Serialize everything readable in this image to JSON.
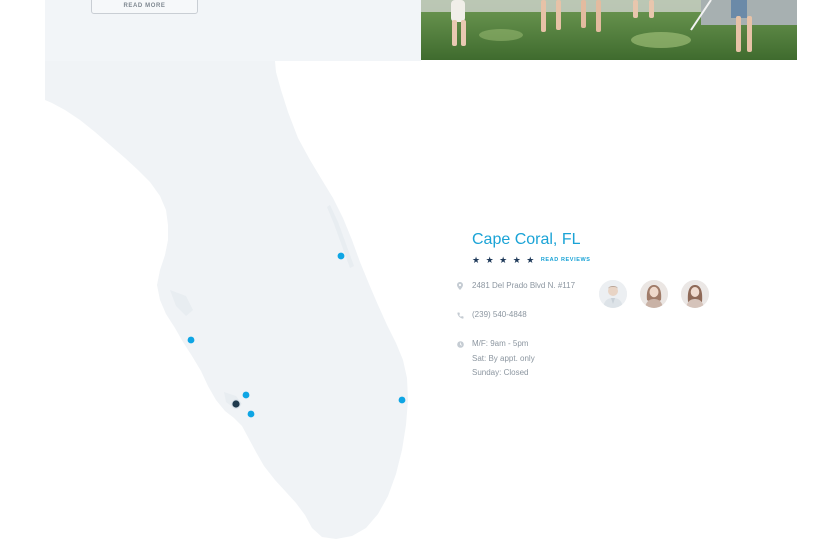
{
  "intro": {
    "read_more_label": "READ MORE"
  },
  "photo": {
    "icon": "family-photo-icon"
  },
  "map": {
    "region": "florida-outline",
    "land_color": "#f0f3f6",
    "marker_color": "#0ea5e4",
    "active_marker_color": "#1f3a4d",
    "markers": [
      {
        "name": "map-marker-east-coast-north"
      },
      {
        "name": "map-marker-west-coast-north"
      },
      {
        "name": "map-marker-cape-coral-active"
      },
      {
        "name": "map-marker-fort-myers-north"
      },
      {
        "name": "map-marker-fort-myers-south"
      },
      {
        "name": "map-marker-east-coast-south"
      }
    ]
  },
  "location": {
    "title": "Cape Coral, FL",
    "stars": "★ ★ ★ ★ ★",
    "read_reviews_label": "READ REVIEWS",
    "address": "2481 Del Prado Blvd N. #117",
    "phone": "(239) 540-4848",
    "hours": [
      "M/F: 9am - 5pm",
      "Sat: By appt. only",
      "Sunday: Closed"
    ],
    "icons": {
      "address": "location-pin-icon",
      "phone": "phone-icon",
      "hours": "clock-icon"
    },
    "team": [
      {
        "name": "team-avatar-male"
      },
      {
        "name": "team-avatar-female-1"
      },
      {
        "name": "team-avatar-female-2"
      }
    ]
  }
}
